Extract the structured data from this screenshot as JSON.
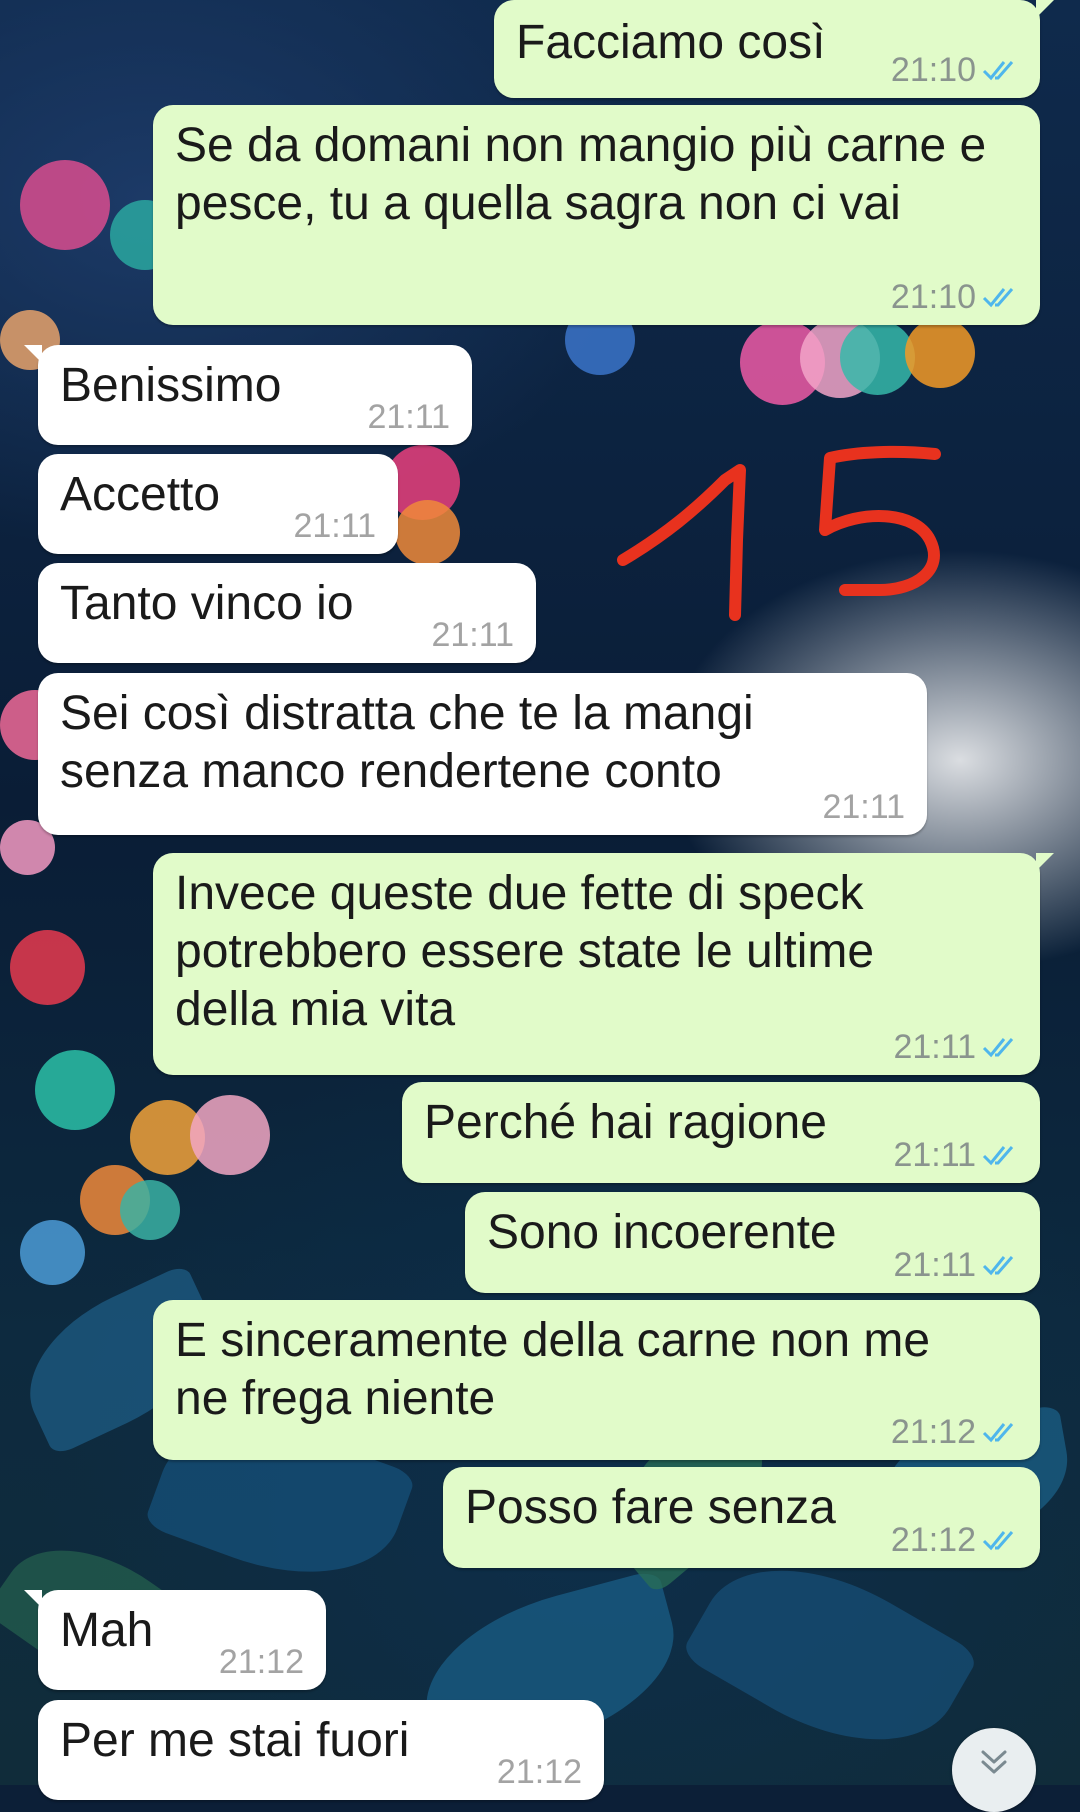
{
  "chat": {
    "messages": [
      {
        "direction": "outgoing",
        "text": "Facciamo così",
        "time": "21:10",
        "status": "read"
      },
      {
        "direction": "outgoing",
        "text": "Se da domani non mangio più carne e pesce, tu a quella sagra non ci vai",
        "time": "21:10",
        "status": "read"
      },
      {
        "direction": "incoming",
        "text": "Benissimo",
        "time": "21:11"
      },
      {
        "direction": "incoming",
        "text": "Accetto",
        "time": "21:11"
      },
      {
        "direction": "incoming",
        "text": "Tanto vinco io",
        "time": "21:11"
      },
      {
        "direction": "incoming",
        "text": "Sei così distratta che te la mangi senza manco rendertene conto",
        "time": "21:11"
      },
      {
        "direction": "outgoing",
        "text": "Invece queste due fette di speck potrebbero essere state le ultime della mia vita",
        "time": "21:11",
        "status": "read"
      },
      {
        "direction": "outgoing",
        "text": "Perché hai ragione",
        "time": "21:11",
        "status": "read"
      },
      {
        "direction": "outgoing",
        "text": "Sono incoerente",
        "time": "21:11",
        "status": "read"
      },
      {
        "direction": "outgoing",
        "text": "E sinceramente della carne non me ne frega niente",
        "time": "21:12",
        "status": "read"
      },
      {
        "direction": "outgoing",
        "text": "Posso fare senza",
        "time": "21:12",
        "status": "read"
      },
      {
        "direction": "incoming",
        "text": "Mah",
        "time": "21:12"
      },
      {
        "direction": "incoming",
        "text": "Per me stai fuori",
        "time": "21:12"
      }
    ]
  },
  "annotation": {
    "text": "15",
    "color": "#e8321e"
  },
  "scroll_button": {
    "icon": "double-chevron-down-icon"
  },
  "colors": {
    "outgoing_bubble": "#e1fbc9",
    "incoming_bubble": "#ffffff",
    "read_ticks": "#4fb6ec",
    "timestamp": "#8a948e"
  }
}
